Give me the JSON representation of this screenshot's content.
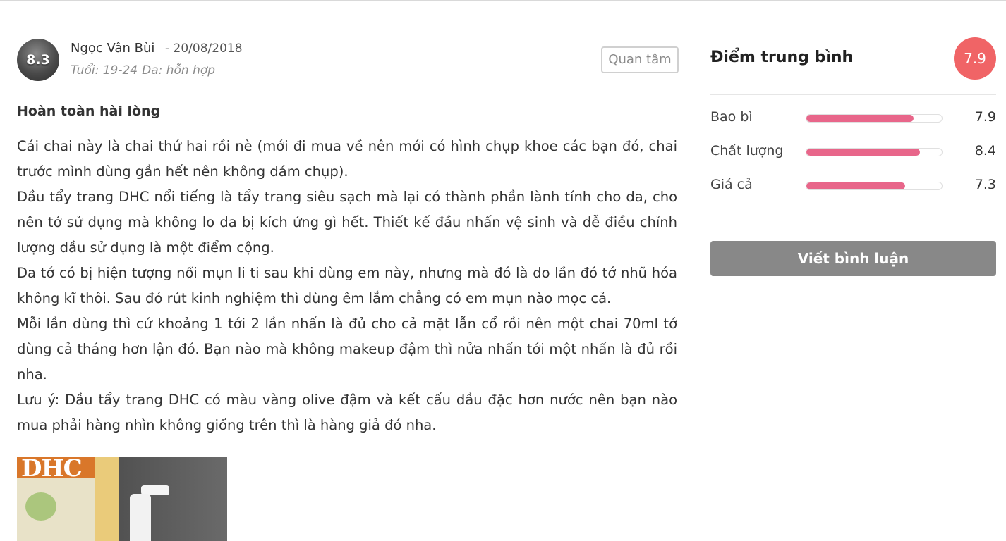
{
  "review": {
    "reviewer_score": "8.3",
    "username": "Ngọc Vân Bùi",
    "date": "- 20/08/2018",
    "age": "Tuổi: 19-24",
    "skin": "Da: hỗn hợp",
    "follow_label": "Quan tâm",
    "title": "Hoàn toàn hài lòng",
    "paragraphs": [
      "Cái chai này là chai thứ hai rồi nè (mới đi mua về nên mới có hình chụp khoe các bạn đó, chai trước mình dùng gần hết nên không dám chụp).",
      "Dầu tẩy trang DHC nổi tiếng là tẩy trang siêu sạch mà lại có thành phần lành tính cho da, cho nên tớ sử dụng mà không lo da bị kích ứng gì hết. Thiết kế đầu nhấn vệ sinh và dễ điều chỉnh lượng dầu sử dụng là một điểm cộng.",
      "Da tớ có bị hiện tượng nổi mụn li ti sau khi dùng em này, nhưng mà đó là do lần đó tớ nhũ hóa không kĩ thôi. Sau đó rút kinh nghiệm thì dùng êm lắm chẳng có em mụn nào mọc cả.",
      "Mỗi lần dùng thì cứ khoảng 1 tới 2 lần nhấn là đủ cho cả mặt lẫn cổ rồi nên một chai 70ml tớ dùng cả tháng hơn lận đó. Bạn nào mà không makeup đậm thì nửa nhấn tới một nhấn là đủ rồi nha.",
      "Lưu ý: Dầu tẩy trang DHC có màu vàng olive đậm và kết cấu dầu đặc hơn nước nên bạn nào mua phải hàng nhìn không giống trên thì là hàng giả đó nha."
    ],
    "photo_logo": "DHC"
  },
  "rating": {
    "title": "Điểm trung bình",
    "average": "7.9",
    "criteria": [
      {
        "label": "Bao bì",
        "value": "7.9",
        "score": 7.9
      },
      {
        "label": "Chất lượng",
        "value": "8.4",
        "score": 8.4
      },
      {
        "label": "Giá cả",
        "value": "7.3",
        "score": 7.3
      }
    ],
    "max_score": 10,
    "write_label": "Viết bình luận"
  },
  "colors": {
    "average_badge": "#f06466",
    "bar_fill": "#e8668a",
    "write_button": "#888888"
  }
}
